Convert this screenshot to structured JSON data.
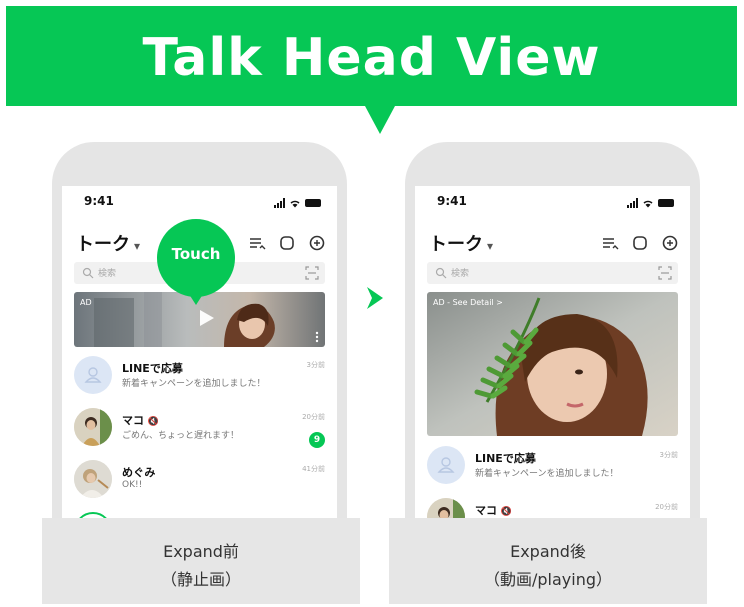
{
  "banner": {
    "title": "Talk Head View"
  },
  "touch_label": "Touch",
  "phones": [
    {
      "time": "9:41",
      "header_title": "トーク",
      "header_caret": "▾",
      "search_placeholder": "検索",
      "ad_label": "AD",
      "chats": [
        {
          "name": "LINEで応募",
          "message": "新着キャンペーンを追加しました！",
          "time": "3分前",
          "unread": ""
        },
        {
          "name": "マコ",
          "message": "ごめん、ちょっと遅れます！",
          "time": "20分前",
          "unread": "9"
        },
        {
          "name": "めぐみ",
          "message": "OK!!",
          "time": "41分前",
          "unread": ""
        }
      ]
    },
    {
      "time": "9:41",
      "header_title": "トーク",
      "header_caret": "▾",
      "search_placeholder": "検索",
      "ad_label": "AD - See Detail >",
      "chats": [
        {
          "name": "LINEで応募",
          "message": "新着キャンペーンを追加しました！",
          "time": "3分前",
          "unread": ""
        },
        {
          "name": "マコ",
          "message": "",
          "time": "20分前",
          "unread": ""
        }
      ]
    }
  ],
  "captions": [
    {
      "line1": "Expand前",
      "line2": "（静止画）"
    },
    {
      "line1": "Expand後",
      "line2": "（動画/playing）"
    }
  ],
  "colors": {
    "brand_green": "#06c755",
    "caption_bg": "#e6e6e6",
    "phone_frame": "#e5e5e5"
  }
}
